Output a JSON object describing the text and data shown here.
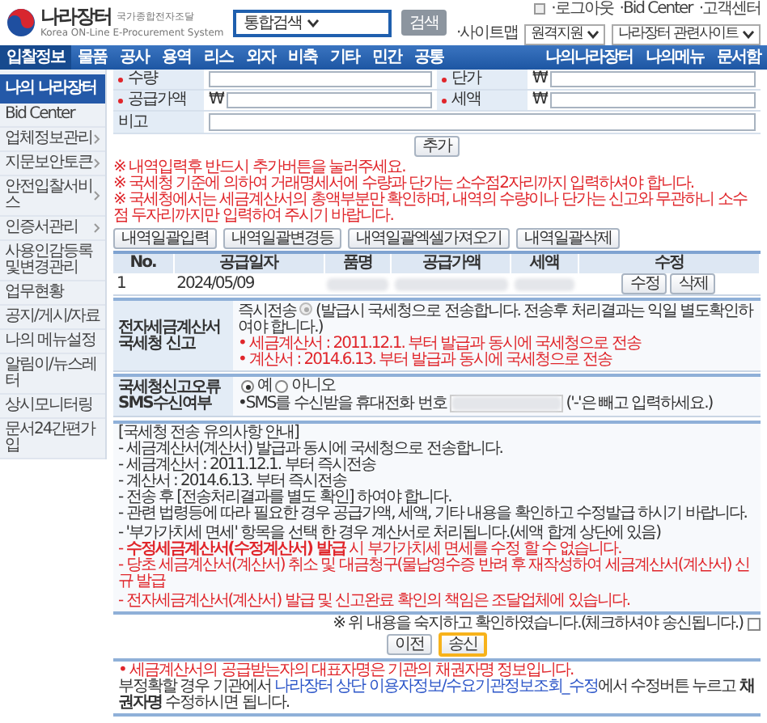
{
  "header": {
    "logo_title": "나라장터",
    "logo_subtitle": "국가종합전자조달",
    "logo_english": "Korea ON-Line E-Procurement System",
    "search_scope": "통합검색",
    "search_button": "검색",
    "top_links": [
      "·로그아웃",
      "·Bid Center",
      "·고객센터"
    ],
    "sitemap": "·사이트맵",
    "remote_select": "원격지원",
    "related_select": "나라장터 관련사이트"
  },
  "nav": {
    "items": [
      {
        "label": "입찰정보",
        "selected": true
      },
      {
        "label": "물품",
        "selected": false
      },
      {
        "label": "공사",
        "selected": false
      },
      {
        "label": "용역",
        "selected": false
      },
      {
        "label": "리스",
        "selected": false
      },
      {
        "label": "외자",
        "selected": false
      },
      {
        "label": "비축",
        "selected": false
      },
      {
        "label": "기타",
        "selected": false
      },
      {
        "label": "민간",
        "selected": false
      },
      {
        "label": "공통",
        "selected": false
      }
    ],
    "right_items": [
      "나의나라장터",
      "나의메뉴",
      "문서함"
    ]
  },
  "sidebar": {
    "title": "나의 나라장터",
    "items": [
      {
        "label": "Bid Center",
        "expandable": false
      },
      {
        "label": "업체정보관리",
        "expandable": true
      },
      {
        "label": "지문보안토큰",
        "expandable": true
      },
      {
        "label": "안전입찰서비스",
        "expandable": true
      },
      {
        "label": "인증서관리",
        "expandable": true
      },
      {
        "label": "사용인감등록및변경관리",
        "expandable": false
      },
      {
        "label": "업무현황",
        "expandable": false
      },
      {
        "label": "공지/게시/자료",
        "expandable": false
      },
      {
        "label": "나의 메뉴설정",
        "expandable": false
      },
      {
        "label": "알림이/뉴스레터",
        "expandable": false
      },
      {
        "label": "상시모니터링",
        "expandable": false
      },
      {
        "label": "문서24간편가입",
        "expandable": false
      }
    ]
  },
  "form": {
    "rows": [
      [
        {
          "label": "수량",
          "required": true
        },
        {
          "label": "단가",
          "required": true,
          "prefix": "₩"
        }
      ],
      [
        {
          "label": "공급가액",
          "required": true,
          "prefix": "₩"
        },
        {
          "label": "세액",
          "required": true,
          "prefix": "₩"
        }
      ],
      [
        {
          "label": "비고",
          "required": false
        }
      ]
    ]
  },
  "add_button": "추가",
  "notes": [
    "※ 내역입력후 반드시 추가버튼을 눌러주세요.",
    "※ 국세청 기준에 의하여 거래명세서에 수량과 단가는 소수점2자리까지 입력하셔야 합니다.",
    "※ 국세청에서는 세금계산서의 총액부분만 확인하며, 내역의 수량이나 단가는 신고와 무관하니 소수점 두자리까지만 입력하여 주시기 바랍니다."
  ],
  "bulk_buttons": [
    "내역일괄입력",
    "내역일괄변경등",
    "내역일괄엑셀가져오기",
    "내역일괄삭제"
  ],
  "table": {
    "columns": [
      "No.",
      "공급일자",
      "품명",
      "공급가액",
      "세액",
      "수정"
    ],
    "rows": [
      {
        "no": "1",
        "date": "2024/05/09",
        "actions": [
          "수정",
          "삭제"
        ]
      }
    ]
  },
  "etax": {
    "label": "전자세금계산서 국세청 신고",
    "option": {
      "label": "즉시전송",
      "checked": true
    },
    "description": "(발급시 국세청으로 전송합니다. 전송후 처리결과는 익일 별도확인하여야 합니다.)",
    "bullets": [
      "• 세금계산서 : 2011.12.1. 부터 발급과 동시에 국세청으로 전송",
      "• 계산서 : 2014.6.13. 부터 발급과 동시에 국세청으로 전송"
    ]
  },
  "sms": {
    "label": "국세청신고오류 SMS수신여부",
    "options": [
      {
        "label": "예",
        "selected": true
      },
      {
        "label": "아니오",
        "selected": false
      }
    ],
    "phone_label": "•SMS를 수신받을 휴대전화 번호",
    "phone_hint": "('-'은 빼고 입력하세요.)"
  },
  "notice": {
    "title": "[국세청 전송 유의사항 안내]",
    "lines": [
      {
        "text": "- 세금계산서(계산서) 발급과 동시에 국세청으로 전송합니다.",
        "kind": "normal",
        "gap_before": false
      },
      {
        "text": "- 세금계산서 : 2011.12.1. 부터 즉시전송",
        "kind": "normal",
        "gap_before": false
      },
      {
        "text": "- 계산서 : 2014.6.13. 부터 즉시전송",
        "kind": "normal",
        "gap_before": false
      },
      {
        "text": "- 전송 후 [전송처리결과를 별도 확인] 하여야 합니다.",
        "kind": "normal",
        "gap_before": false
      },
      {
        "text": "- 관련 법령등에 따라 필요한 경우 공급가액, 세액, 기타 내용을 확인하고 수정발급 하시기 바랍니다.",
        "kind": "normal",
        "gap_before": false
      },
      {
        "text": "- '부가가치세 면세' 항목을 선택 한 경우 계산서로 처리됩니다.(세액 합계 상단에 있음)",
        "kind": "normal",
        "gap_before": true
      },
      {
        "text": "- **수정세금계산서(수정계산서) 발급** 시 부가가치세 면세를 수정 할 수 없습니다.",
        "kind": "warning",
        "gap_before": false
      },
      {
        "text": "- 당초 세금계산서(계산서) 취소 및 대금청구(물납영수증 반려 후 재작성하여 세금계산서(계산서) 신규 발급",
        "kind": "warning",
        "gap_before": false
      },
      {
        "text": "- 전자세금계산서(계산서) 발급 및 신고완료 확인의 책임은 조달업체에 있습니다.",
        "kind": "warning",
        "gap_before": true
      }
    ]
  },
  "confirm": {
    "text": "※ 위 내용을 숙지하고 확인하였습니다.(체크하셔야 송신됩니다.)",
    "checked": false
  },
  "actions": [
    {
      "label": "이전",
      "highlighted": false
    },
    {
      "label": "송신",
      "highlighted": true
    }
  ],
  "footer": {
    "warning": "• 세금계산서의 공급받는자의 대표자명은 기관의 채권자명 정보입니다.",
    "before": "부정확할 경우 기관에서 ",
    "link": "나라장터 상단 이용자정보/수요기관정보조회_수정",
    "after": "에서 수정버튼 누르고 **채권자명** 수정하시면 됩니다."
  }
}
